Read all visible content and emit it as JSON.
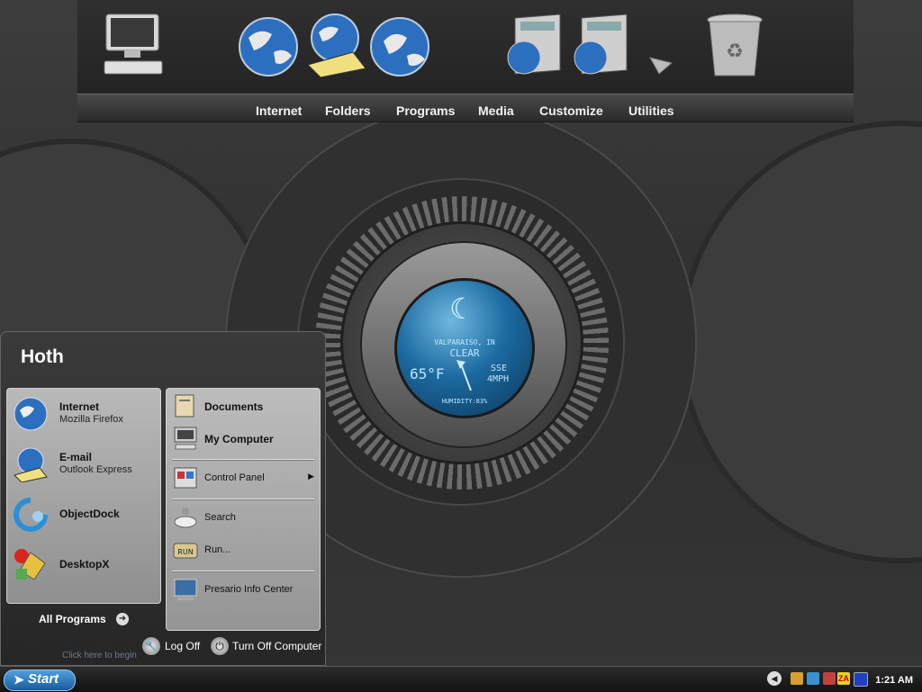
{
  "dock": {
    "icons": [
      {
        "name": "my-computer-icon"
      },
      {
        "name": "internet-globe-icon"
      },
      {
        "name": "email-globe-icon"
      },
      {
        "name": "network-globe-icon"
      },
      {
        "name": "explorer-window-icon"
      },
      {
        "name": "explorer-window-icon-2"
      },
      {
        "name": "dock-pointer-icon"
      },
      {
        "name": "recycle-bin-icon"
      }
    ]
  },
  "menubar": {
    "items": [
      "Internet",
      "Folders",
      "Programs",
      "Media",
      "Customize",
      "Utilities"
    ]
  },
  "weather": {
    "location": "VALPARAISO, IN",
    "condition": "CLEAR",
    "temperature": "65°F",
    "wind_dir": "SSE",
    "wind_speed": "4MPH",
    "humidity": "HUMIDITY:83%"
  },
  "start_menu": {
    "user": "Hoth",
    "pinned": [
      {
        "title": "Internet",
        "subtitle": "Mozilla Firefox"
      },
      {
        "title": "E-mail",
        "subtitle": "Outlook Express"
      },
      {
        "title": "ObjectDock",
        "subtitle": ""
      },
      {
        "title": "DesktopX",
        "subtitle": ""
      }
    ],
    "all_programs": "All Programs",
    "places": {
      "documents": "Documents",
      "my_computer": "My Computer",
      "control_panel": "Control Panel",
      "search": "Search",
      "run": "Run...",
      "presario": "Presario Info Center"
    },
    "log_off": "Log Off",
    "turn_off": "Turn Off Computer",
    "tip": "Click here to begin"
  },
  "taskbar": {
    "start": "Start",
    "clock": "1:21 AM",
    "tray_za": "ZA"
  }
}
